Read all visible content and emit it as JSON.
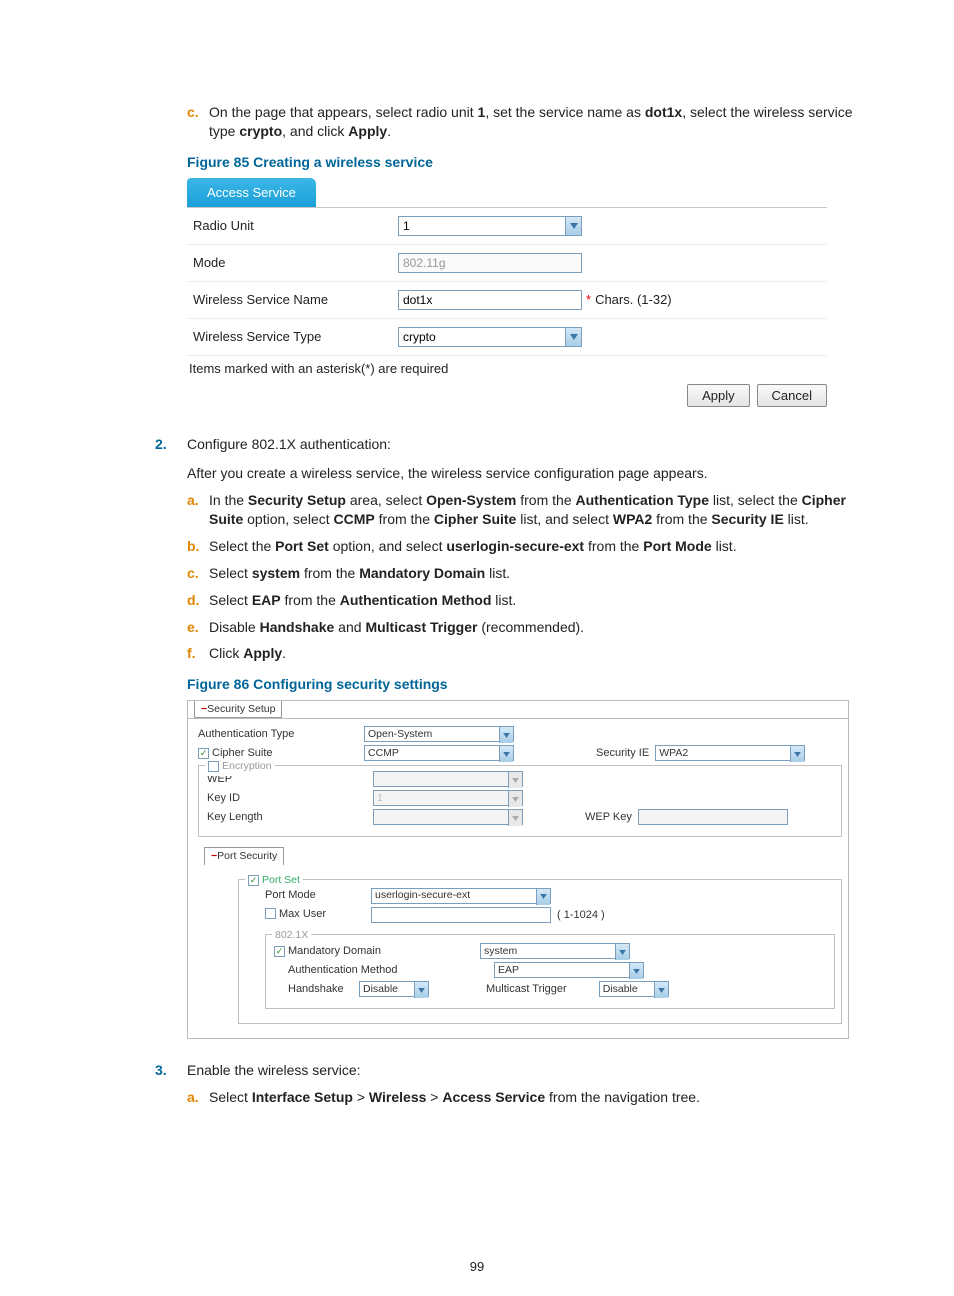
{
  "step_c": {
    "marker": "c.",
    "text_1": "On the page that appears, select radio unit ",
    "b1": "1",
    "text_2": ", set the service name as ",
    "b2": "dot1x",
    "text_3": ", select the wireless service type ",
    "b3": "crypto",
    "text_4": ", and click ",
    "b4": "Apply",
    "text_5": "."
  },
  "fig85": {
    "caption": "Figure 85 Creating a wireless service",
    "tab": "Access Service",
    "radio_unit_label": "Radio Unit",
    "radio_unit_value": "1",
    "mode_label": "Mode",
    "mode_value": "802.11g",
    "svc_name_label": "Wireless Service Name",
    "svc_name_value": "dot1x",
    "svc_name_req": "*",
    "svc_name_hint": " Chars. (1-32)",
    "svc_type_label": "Wireless Service Type",
    "svc_type_value": "crypto",
    "note": "Items marked with an asterisk(*) are required",
    "apply": "Apply",
    "cancel": "Cancel"
  },
  "step2": {
    "marker": "2.",
    "line1": "Configure 802.1X authentication:",
    "line2": "After you create a wireless service, the wireless service configuration page appears.",
    "a": {
      "marker": "a.",
      "t1": "In the ",
      "b1": "Security Setup",
      "t2": " area, select ",
      "b2": "Open-System",
      "t3": " from the ",
      "b3": "Authentication Type",
      "t4": " list, select the ",
      "b4": "Cipher Suite",
      "t5": " option, select ",
      "b5": "CCMP",
      "t6": " from the ",
      "b6": "Cipher Suite",
      "t7": " list, and select ",
      "b7": "WPA2",
      "t8": " from the ",
      "b8": "Security IE",
      "t9": " list."
    },
    "b": {
      "marker": "b.",
      "t1": "Select the ",
      "b1": "Port Set",
      "t2": " option, and select ",
      "b2": "userlogin-secure-ext",
      "t3": " from the ",
      "b3": "Port Mode",
      "t4": " list."
    },
    "c": {
      "marker": "c.",
      "t1": "Select ",
      "b1": "system",
      "t2": " from the ",
      "b2": "Mandatory Domain",
      "t3": " list."
    },
    "d": {
      "marker": "d.",
      "t1": "Select ",
      "b1": "EAP",
      "t2": " from the ",
      "b2": "Authentication Method",
      "t3": " list."
    },
    "e": {
      "marker": "e.",
      "t1": "Disable ",
      "b1": "Handshake",
      "t2": " and ",
      "b2": "Multicast Trigger",
      "t3": " (recommended)."
    },
    "f": {
      "marker": "f.",
      "t1": "Click ",
      "b1": "Apply",
      "t2": "."
    }
  },
  "fig86": {
    "caption": "Figure 86 Configuring security settings",
    "tab": "Security Setup",
    "auth_type_label": "Authentication Type",
    "auth_type_value": "Open-System",
    "cipher_suite_label": "Cipher Suite",
    "cipher_suite_value": "CCMP",
    "security_ie_label": "Security IE",
    "security_ie_value": "WPA2",
    "encryption_legend": "Encryption",
    "wep_label": "WEP",
    "key_id_label": "Key ID",
    "key_id_value": "1",
    "key_length_label": "Key Length",
    "wep_key_label": "WEP Key",
    "port_security_tab": "Port Security",
    "port_set_label": "Port Set",
    "port_mode_label": "Port Mode",
    "port_mode_value": "userlogin-secure-ext",
    "max_user_label": "Max User",
    "max_user_hint": "( 1-1024 )",
    "8021x_legend": "802.1X",
    "mandatory_domain_label": "Mandatory Domain",
    "mandatory_domain_value": "system",
    "auth_method_label": "Authentication Method",
    "auth_method_value": "EAP",
    "handshake_label": "Handshake",
    "handshake_value": "Disable",
    "multicast_trigger_label": "Multicast Trigger",
    "multicast_trigger_value": "Disable"
  },
  "step3": {
    "marker": "3.",
    "line1": "Enable the wireless service:",
    "a": {
      "marker": "a.",
      "t1": "Select ",
      "b1": "Interface Setup",
      "t2": " > ",
      "b2": "Wireless",
      "t3": " > ",
      "b3": "Access Service",
      "t4": " from the navigation tree."
    }
  },
  "page_number": "99"
}
